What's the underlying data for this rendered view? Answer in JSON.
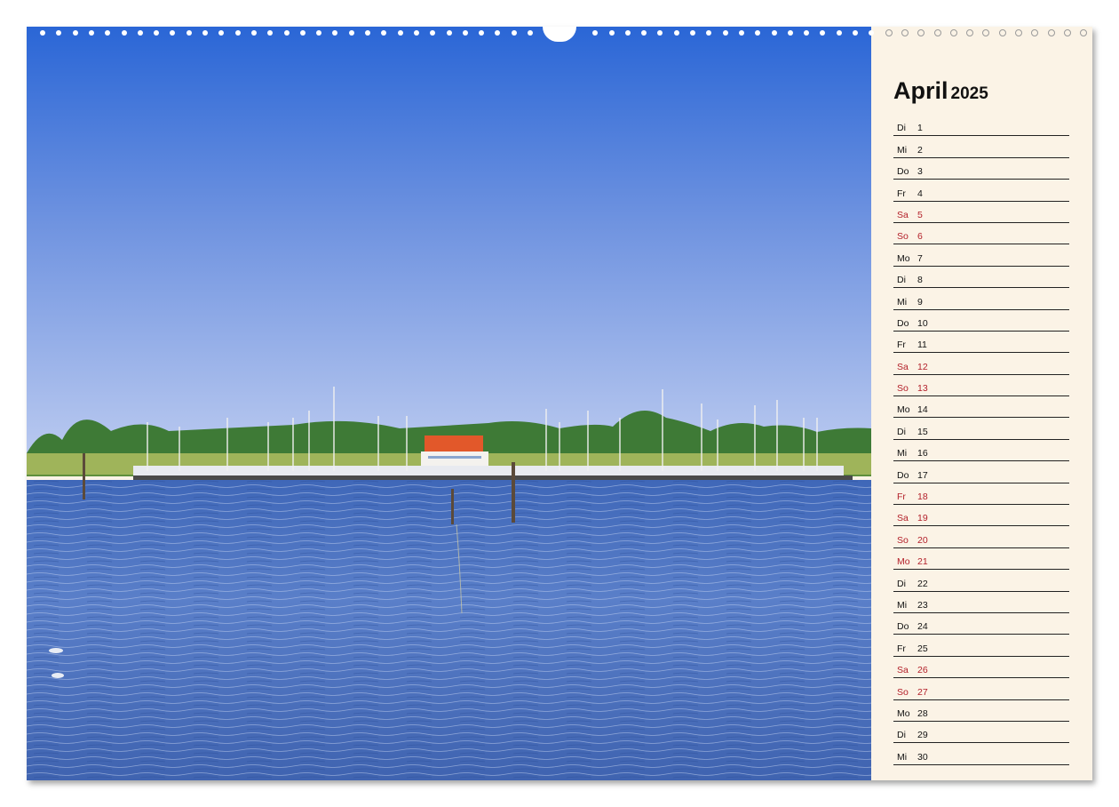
{
  "calendar": {
    "month": "April",
    "year": "2025",
    "days": [
      {
        "name": "Di",
        "num": "1",
        "red": false
      },
      {
        "name": "Mi",
        "num": "2",
        "red": false
      },
      {
        "name": "Do",
        "num": "3",
        "red": false
      },
      {
        "name": "Fr",
        "num": "4",
        "red": false
      },
      {
        "name": "Sa",
        "num": "5",
        "red": true
      },
      {
        "name": "So",
        "num": "6",
        "red": true
      },
      {
        "name": "Mo",
        "num": "7",
        "red": false
      },
      {
        "name": "Di",
        "num": "8",
        "red": false
      },
      {
        "name": "Mi",
        "num": "9",
        "red": false
      },
      {
        "name": "Do",
        "num": "10",
        "red": false
      },
      {
        "name": "Fr",
        "num": "11",
        "red": false
      },
      {
        "name": "Sa",
        "num": "12",
        "red": true
      },
      {
        "name": "So",
        "num": "13",
        "red": true
      },
      {
        "name": "Mo",
        "num": "14",
        "red": false
      },
      {
        "name": "Di",
        "num": "15",
        "red": false
      },
      {
        "name": "Mi",
        "num": "16",
        "red": false
      },
      {
        "name": "Do",
        "num": "17",
        "red": false
      },
      {
        "name": "Fr",
        "num": "18",
        "red": true
      },
      {
        "name": "Sa",
        "num": "19",
        "red": true
      },
      {
        "name": "So",
        "num": "20",
        "red": true
      },
      {
        "name": "Mo",
        "num": "21",
        "red": true
      },
      {
        "name": "Di",
        "num": "22",
        "red": false
      },
      {
        "name": "Mi",
        "num": "23",
        "red": false
      },
      {
        "name": "Do",
        "num": "24",
        "red": false
      },
      {
        "name": "Fr",
        "num": "25",
        "red": false
      },
      {
        "name": "Sa",
        "num": "26",
        "red": true
      },
      {
        "name": "So",
        "num": "27",
        "red": true
      },
      {
        "name": "Mo",
        "num": "28",
        "red": false
      },
      {
        "name": "Di",
        "num": "29",
        "red": false
      },
      {
        "name": "Mi",
        "num": "30",
        "red": false
      }
    ]
  },
  "colors": {
    "paper": "#fbf3e6",
    "holiday_text": "#b3202a",
    "sky_top": "#2f6fd8",
    "sky_horizon": "#b7c8ef",
    "water": "#5077c2",
    "roof": "#e0552b"
  },
  "photo": {
    "subject-icons": [
      "marina-harbor",
      "red-roof-house",
      "sailboat-masts",
      "tree-line",
      "mooring-poles",
      "water"
    ]
  }
}
